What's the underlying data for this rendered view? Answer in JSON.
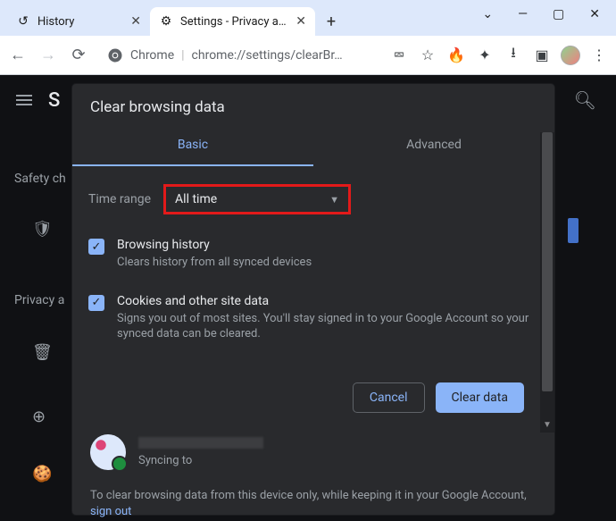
{
  "window": {
    "min": "—",
    "max": "▢",
    "close": "✕",
    "down": "⌄"
  },
  "tabs": {
    "history": {
      "label": "History",
      "close": "✕"
    },
    "settings": {
      "label": "Settings - Privacy and",
      "close": "✕"
    },
    "newtab": "+"
  },
  "toolbar": {
    "back": "←",
    "fwd": "→",
    "reload": "⟳",
    "chrome_label": "Chrome",
    "sep": "|",
    "url": "chrome://settings/clearBr…",
    "share": "⮹",
    "star": "☆",
    "fire": "🔥",
    "ext": "✦",
    "dl": "⭳",
    "reader": "▣",
    "menu": "⋮"
  },
  "bg": {
    "title_initial": "S",
    "safety": "Safety ch",
    "privacy": "Privacy a"
  },
  "dialog": {
    "title": "Clear browsing data",
    "tab_basic": "Basic",
    "tab_advanced": "Advanced",
    "time_range_label": "Time range",
    "time_range_value": "All time",
    "opt1": {
      "h": "Browsing history",
      "s": "Clears history from all synced devices"
    },
    "opt2": {
      "h": "Cookies and other site data",
      "s": "Signs you out of most sites. You'll stay signed in to your Google Account so your synced data can be cleared."
    },
    "cancel": "Cancel",
    "clear": "Clear data",
    "syncing": "Syncing to",
    "footnote_a": "To clear browsing data from this device only, while keeping it in your Google Account, ",
    "footnote_link": "sign out"
  }
}
